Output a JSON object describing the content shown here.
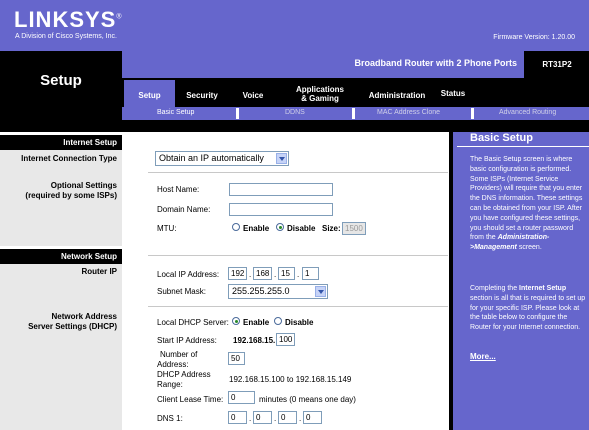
{
  "header": {
    "logo": "LINKSYS",
    "logo_mark": "®",
    "logo_subtitle": "A Division of Cisco Systems, Inc.",
    "firmware": "Firmware Version: 1.20.00",
    "product_name": "Broadband Router with 2 Phone Ports",
    "model": "RT31P2",
    "page_title": "Setup"
  },
  "tabs": [
    {
      "label": "Setup"
    },
    {
      "label": "Security"
    },
    {
      "label": "Voice"
    },
    {
      "label": "Applications\n& Gaming"
    },
    {
      "label": "Administration"
    },
    {
      "label": "Status"
    }
  ],
  "subtabs": [
    "Basic Setup",
    "DDNS",
    "MAC Address Clone",
    "Advanced Routing"
  ],
  "sections": {
    "internet_setup": "Internet Setup",
    "network_setup": "Network Setup"
  },
  "labels": {
    "connection_type": "Internet Connection Type",
    "optional_1": "Optional Settings",
    "optional_2": "(required by some ISPs)",
    "router_ip": "Router IP",
    "nas_1": "Network Address",
    "nas_2": "Server Settings (DHCP)"
  },
  "internet": {
    "connection_type_value": "Obtain an IP automatically",
    "host_name_label": "Host Name:",
    "host_name_value": "",
    "domain_name_label": "Domain Name:",
    "domain_name_value": "",
    "mtu_label": "MTU:",
    "mtu_enable": "Enable",
    "mtu_disable": "Disable",
    "mtu_selected": "Disable",
    "size_label": "Size:",
    "size_value": "1500"
  },
  "network": {
    "local_ip_label": "Local IP Address:",
    "local_ip": [
      "192",
      "168",
      "15",
      "1"
    ],
    "subnet_label": "Subnet Mask:",
    "subnet_value": "255.255.255.0"
  },
  "dhcp": {
    "server_label": "Local DHCP Server:",
    "enable": "Enable",
    "disable": "Disable",
    "selected": "Enable",
    "start_ip_label": "Start IP Address:",
    "start_ip_prefix": "192.168.15.",
    "start_ip_last": "100",
    "num_label_1": "Number  of",
    "num_label_2": "Address:",
    "num_value": "50",
    "range_label_1": "DHCP  Address",
    "range_label_2": "Range:",
    "range_value": "192.168.15.100 to 192.168.15.149",
    "lease_label": "Client Lease Time:",
    "lease_value": "0",
    "lease_suffix": "minutes (0 means one day)",
    "dns1_label": "DNS 1:",
    "dns1": [
      "0",
      "0",
      "0",
      "0"
    ]
  },
  "help": {
    "title": "Basic Setup",
    "p1_a": "The Basic Setup screen is where basic configuration is performed. Some ISPs (Internet Service Providers) will require that you enter the DNS information. These settings can be obtained from your ISP. After you have configured these settings, you should set a router password from the ",
    "p1_em": "Administration->Management",
    "p1_b": " screen.",
    "p2_a": "Completing the ",
    "p2_strong": "Internet Setup",
    "p2_b": " section is all that is required to set up for your specific ISP. Please look at the table below to configure the Router for your Internet connection.",
    "more": "More..."
  },
  "colors": {
    "brand": "#6666cc",
    "band": "#000000",
    "left_panel": "#e8e8e8"
  }
}
